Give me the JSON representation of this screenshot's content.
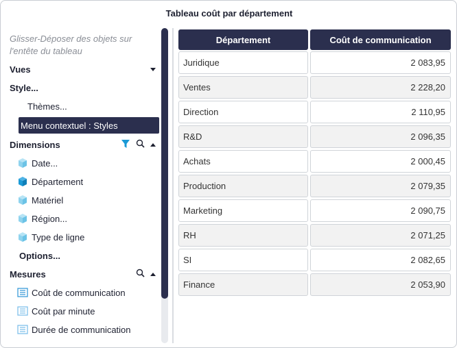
{
  "title": "Tableau coût par département",
  "sidebar": {
    "hint": "Glisser-Déposer des objets sur l'entête du tableau",
    "vues": "Vues",
    "style": "Style...",
    "themes": "Thèmes...",
    "menu_contextuel": "Menu contextuel : Styles",
    "dimensions": {
      "label": "Dimensions",
      "items": [
        "Date...",
        "Département",
        "Matériel",
        "Région...",
        "Type de ligne"
      ]
    },
    "options": "Options...",
    "mesures": {
      "label": "Mesures",
      "items": [
        "Coût de communication",
        "Coût par minute",
        "Durée de communication"
      ]
    }
  },
  "table": {
    "columns": [
      "Département",
      "Coût de communication"
    ],
    "rows": [
      [
        "Juridique",
        "2 083,95"
      ],
      [
        "Ventes",
        "2 228,20"
      ],
      [
        "Direction",
        "2 110,95"
      ],
      [
        "R&D",
        "2 096,35"
      ],
      [
        "Achats",
        "2 000,45"
      ],
      [
        "Production",
        "2 079,35"
      ],
      [
        "Marketing",
        "2 090,75"
      ],
      [
        "RH",
        "2 071,25"
      ],
      [
        "SI",
        "2 082,65"
      ],
      [
        "Finance",
        "2 053,90"
      ]
    ]
  },
  "colors": {
    "header_bg": "#2b2f4e",
    "dimension_icon": "#8fd3ee",
    "dimension_icon_active": "#1b9ad6",
    "filter_icon": "#1b9ad6",
    "measure_icon": "#3a9bd8"
  },
  "icons": {
    "filter": "filter-icon",
    "search": "search-icon",
    "dimension": "cube-icon",
    "measure": "measure-icon"
  }
}
